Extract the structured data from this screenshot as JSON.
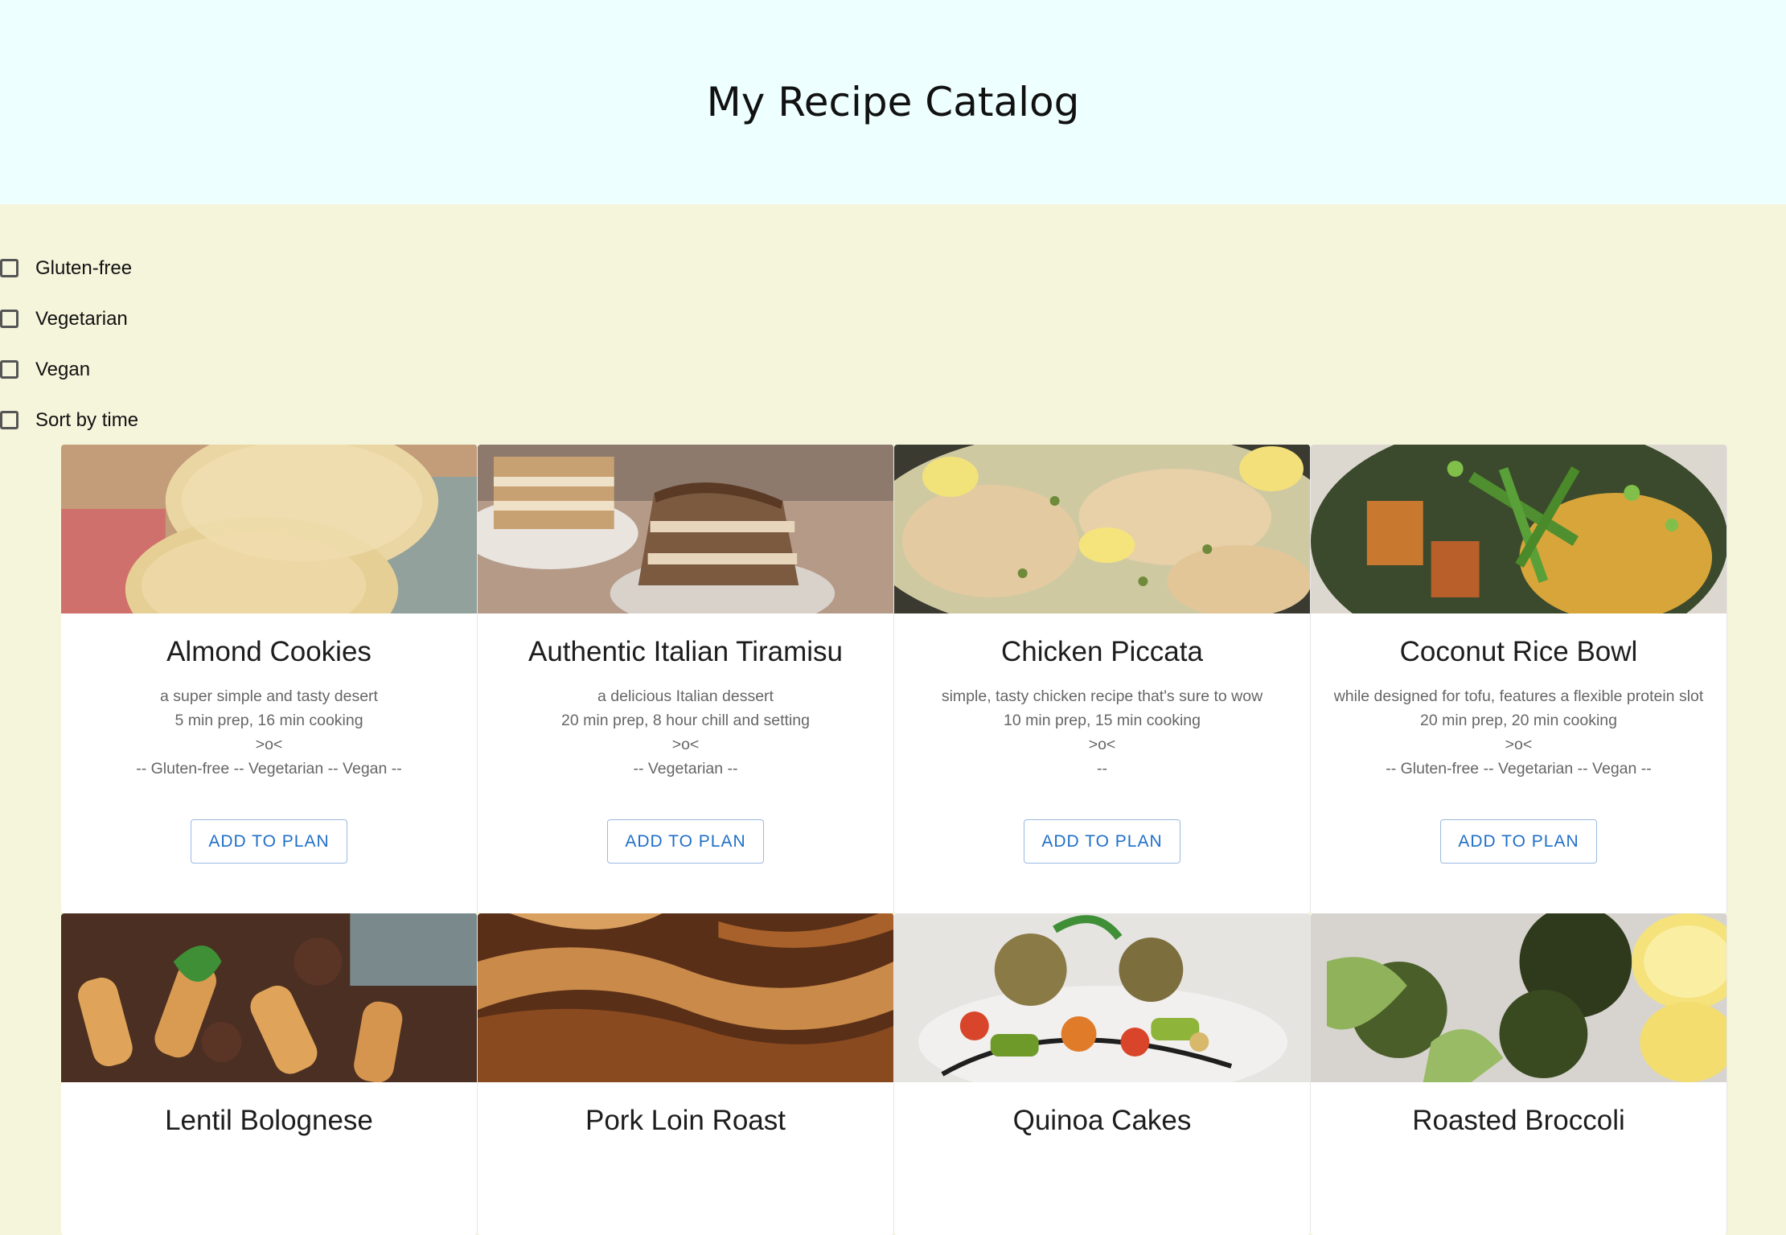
{
  "page": {
    "title": "My Recipe Catalog"
  },
  "filters": [
    {
      "label": "Gluten-free",
      "checked": false
    },
    {
      "label": "Vegetarian",
      "checked": false
    },
    {
      "label": "Vegan",
      "checked": false
    },
    {
      "label": "Sort by time",
      "checked": false
    }
  ],
  "recipes": [
    {
      "name": "Almond Cookies",
      "description": "a super simple and tasty desert",
      "time": "5 min prep, 16 min cooking",
      "face": ">o<",
      "tags": "-- Gluten-free -- Vegetarian -- Vegan --",
      "button": "ADD TO PLAN"
    },
    {
      "name": "Authentic Italian Tiramisu",
      "description": "a delicious Italian dessert",
      "time": "20 min prep, 8 hour chill and setting",
      "face": ">o<",
      "tags": "-- Vegetarian --",
      "button": "ADD TO PLAN"
    },
    {
      "name": "Chicken Piccata",
      "description": "simple, tasty chicken recipe that's sure to wow",
      "time": "10 min prep, 15 min cooking",
      "face": ">o<",
      "tags": "--",
      "button": "ADD TO PLAN"
    },
    {
      "name": "Coconut Rice Bowl",
      "description": "while designed for tofu, features a flexible protein slot",
      "time": "20 min prep, 20 min cooking",
      "face": ">o<",
      "tags": "-- Gluten-free -- Vegetarian -- Vegan --",
      "button": "ADD TO PLAN"
    },
    {
      "name": "Lentil Bolognese"
    },
    {
      "name": "Pork Loin Roast"
    },
    {
      "name": "Quinoa Cakes"
    },
    {
      "name": "Roasted Broccoli"
    }
  ]
}
